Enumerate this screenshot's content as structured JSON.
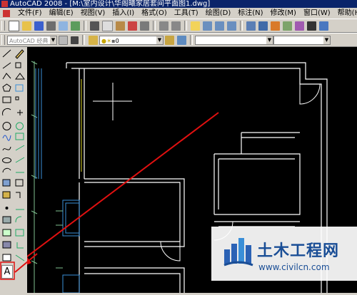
{
  "title": "AutoCAD 2008 - [M:\\室内设计\\华阁曦家居套间平面图1.dwg]",
  "menu": [
    "文件(F)",
    "编辑(E)",
    "视图(V)",
    "插入(I)",
    "格式(O)",
    "工具(T)",
    "绘图(D)",
    "标注(N)",
    "修改(M)",
    "窗口(W)",
    "帮助(H)"
  ],
  "toolbar2": {
    "workspace": "AutoCAD 经典",
    "layer": "0"
  },
  "text_tool": "A",
  "watermark": {
    "title": "土木工程网",
    "url": "www.civilcn.com"
  },
  "colors": {
    "drawing_bg": "#000000",
    "walls": "#ffffff",
    "windows": "#3a8fd8",
    "annotation_arrow": "#e01010",
    "watermark": "#1a4e96"
  },
  "icons": [
    "new-icon",
    "open-icon",
    "save-icon",
    "print-icon",
    "undo-icon",
    "redo-icon",
    "pan-icon",
    "zoom-icon",
    "line-icon",
    "polyline-icon",
    "circle-icon",
    "arc-icon",
    "rectangle-icon",
    "hatch-icon",
    "erase-icon",
    "copy-icon",
    "move-icon",
    "rotate-icon"
  ]
}
